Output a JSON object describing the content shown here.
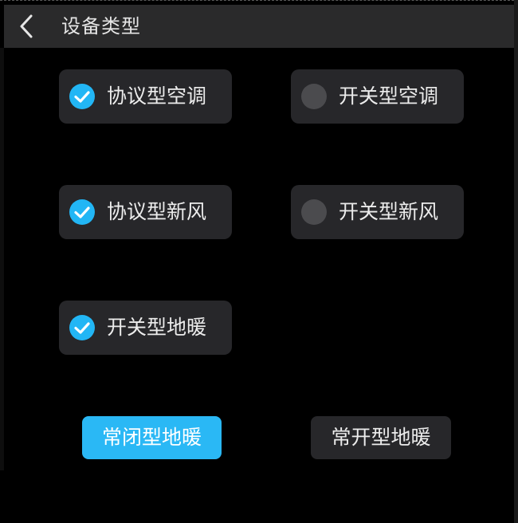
{
  "header": {
    "title": "设备类型"
  },
  "options": [
    {
      "label": "协议型空调",
      "checked": true
    },
    {
      "label": "开关型空调",
      "checked": false
    },
    {
      "label": "协议型新风",
      "checked": true
    },
    {
      "label": "开关型新风",
      "checked": false
    },
    {
      "label": "开关型地暖",
      "checked": true
    }
  ],
  "floor_heating_mode": {
    "normally_closed_label": "常闭型地暖",
    "normally_open_label": "常开型地暖",
    "selected": "常闭型地暖"
  },
  "colors": {
    "accent": "#22b6f5",
    "card": "#27272a",
    "header": "#2a2a2b",
    "background": "#000000"
  }
}
